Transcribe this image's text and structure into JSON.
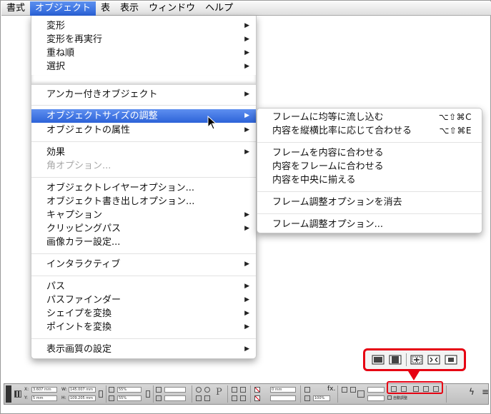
{
  "menubar": {
    "items": [
      "書式",
      "オブジェクト",
      "表",
      "表示",
      "ウィンドウ",
      "ヘルプ"
    ],
    "active_index": 1
  },
  "object_menu": {
    "transform": "変形",
    "transform_again": "変形を再実行",
    "arrange": "重ね順",
    "select": "選択",
    "anchored_object": "アンカー付きオブジェクト",
    "fitting": "オブジェクトサイズの調整",
    "object_attributes": "オブジェクトの属性",
    "effects": "効果",
    "corner_options": "角オプション...",
    "object_layer_options": "オブジェクトレイヤーオプション...",
    "object_export_options": "オブジェクト書き出しオプション...",
    "captions": "キャプション",
    "clipping_path": "クリッピングパス",
    "image_color_settings": "画像カラー設定...",
    "interactive": "インタラクティブ",
    "paths": "パス",
    "pathfinder": "パスファインダー",
    "convert_shape": "シェイプを変換",
    "convert_point": "ポイントを変換",
    "display_performance": "表示画質の設定"
  },
  "fitting_submenu": {
    "fill_frame_proportionally": "フレームに均等に流し込む",
    "fill_frame_shortcut": "⌥⇧⌘C",
    "fit_content_proportionally": "内容を縦横比率に応じて合わせる",
    "fit_content_prop_shortcut": "⌥⇧⌘E",
    "fit_frame_to_content": "フレームを内容に合わせる",
    "fit_content_to_frame": "内容をフレームに合わせる",
    "center_content": "内容を中央に揃える",
    "clear_frame_fitting": "フレーム調整オプションを消去",
    "frame_fitting_options": "フレーム調整オプション..."
  },
  "control_panel": {
    "x_label": "X:",
    "x_value": "3.607 mm",
    "y_label": "Y:",
    "y_value": "5 mm",
    "w_label": "W:",
    "w_value": "145.007 mm",
    "h_label": "H:",
    "h_value": "109.205 mm",
    "scale_x": "55%",
    "scale_y": "55%",
    "stroke_weight": "0 mm",
    "opacity": "100%",
    "auto_fit_label": "自動調整"
  },
  "colors": {
    "highlight": "#2d63d8",
    "callout": "#e60012"
  }
}
